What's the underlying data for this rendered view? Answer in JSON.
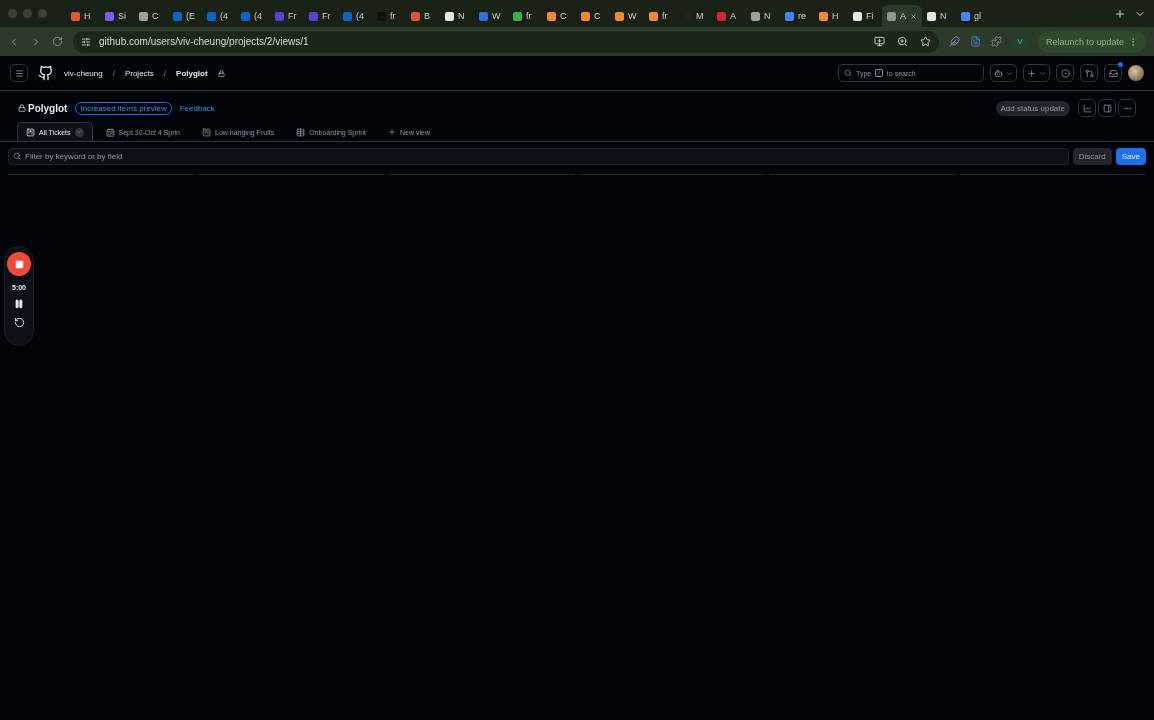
{
  "browser_tabs": [
    {
      "title": "H",
      "color": "#e4572e",
      "selected": false
    },
    {
      "title": "Si",
      "color": "#7b5cf0",
      "selected": false
    },
    {
      "title": "C",
      "color": "#9aa39a",
      "selected": false
    },
    {
      "title": "(E",
      "color": "#0a66c2",
      "selected": false
    },
    {
      "title": "(4",
      "color": "#0a66c2",
      "selected": false
    },
    {
      "title": "(4",
      "color": "#0a66c2",
      "selected": false
    },
    {
      "title": "Fr",
      "color": "#5b3fd6",
      "selected": false
    },
    {
      "title": "Fr",
      "color": "#5b3fd6",
      "selected": false
    },
    {
      "title": "(4",
      "color": "#0a66c2",
      "selected": false
    },
    {
      "title": "fr",
      "color": "#111111",
      "selected": false
    },
    {
      "title": "B",
      "color": "#e0552f",
      "selected": false
    },
    {
      "title": "N",
      "color": "#e6e6e6",
      "selected": false
    },
    {
      "title": "W",
      "color": "#2f6fe0",
      "selected": false
    },
    {
      "title": "fr",
      "color": "#3cae4b",
      "selected": false
    },
    {
      "title": "C",
      "color": "#f08a2c",
      "selected": false
    },
    {
      "title": "C",
      "color": "#f08a2c",
      "selected": false
    },
    {
      "title": "W",
      "color": "#f08a2c",
      "selected": false
    },
    {
      "title": "fr",
      "color": "#f08a2c",
      "selected": false
    },
    {
      "title": "M",
      "color": "#222222",
      "selected": false
    },
    {
      "title": "A",
      "color": "#d6243a",
      "selected": false
    },
    {
      "title": "N",
      "color": "#9aa39a",
      "selected": false
    },
    {
      "title": "re",
      "color": "#4285f4",
      "selected": false
    },
    {
      "title": "H",
      "color": "#f08a2c",
      "selected": false
    },
    {
      "title": "Fi",
      "color": "#e6e6e6",
      "selected": false
    },
    {
      "title": "A",
      "color": "#8e978a",
      "selected": true
    },
    {
      "title": "N",
      "color": "#e6e6e6",
      "selected": false
    },
    {
      "title": "gl",
      "color": "#4285f4",
      "selected": false
    }
  ],
  "address_bar": {
    "url": "github.com/users/viv-cheung/projects/2/views/1",
    "profile": "V",
    "relaunch": "Relaunch to update"
  },
  "header": {
    "breadcrumbs": [
      "viv-cheung",
      "Projects",
      "Polyglot"
    ],
    "separator": "/",
    "search": {
      "before": "Type",
      "key": "/",
      "after": "to search"
    }
  },
  "project": {
    "title": "Polyglot",
    "badge": "Increased items preview",
    "feedback": "Feedback",
    "status_button": "Add status update"
  },
  "views": [
    {
      "label": "All Tickets",
      "kind": "board",
      "selected": true
    },
    {
      "label": "Sept 30-Oct 4 Sprin",
      "kind": "roadmap",
      "selected": false
    },
    {
      "label": "Low hanging Fruits",
      "kind": "board",
      "selected": false
    },
    {
      "label": "Onboarding Sprint",
      "kind": "table",
      "selected": false
    }
  ],
  "new_view": "New view",
  "filter": {
    "placeholder": "Filter by keyword or by field",
    "discard": "Discard",
    "save": "Save"
  },
  "recorder": {
    "time": "5:00"
  }
}
